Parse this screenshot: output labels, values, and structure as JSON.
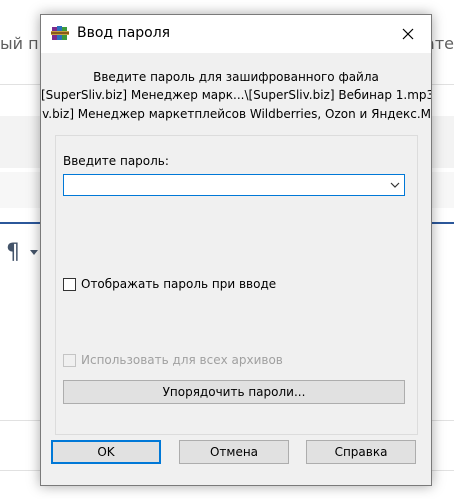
{
  "background": {
    "left_text": "ый пр",
    "right_text": "вате"
  },
  "dialog": {
    "title": "Ввод пароля",
    "icon": "winrar-books-icon",
    "message_line1": "Введите пароль для зашифрованного файла",
    "message_line2": "[SuperSliv.biz] Менеджер марк...\\[SuperSliv.biz] Вебинар 1.mp3",
    "message_line3": "rSliv.biz] Менеджер маркетплейсов Wildberries, Ozon и Яндекс.М",
    "password_label": "Введите пароль:",
    "password_value": "",
    "show_password_label": "Отображать пароль при вводе",
    "show_password_checked": false,
    "use_for_all_label": "Использовать для всех архивов",
    "use_for_all_checked": false,
    "use_for_all_enabled": false,
    "organize_label": "Упорядочить пароли...",
    "ok_label": "OK",
    "cancel_label": "Отмена",
    "help_label": "Справка",
    "accent_color": "#0078d7"
  }
}
